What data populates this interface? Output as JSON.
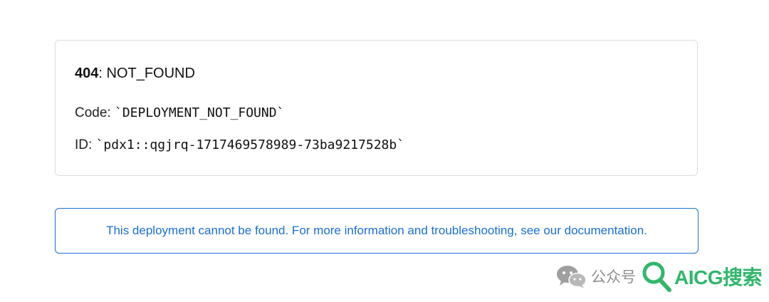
{
  "error": {
    "status_code": "404",
    "separator": ": ",
    "status_text": "NOT_FOUND",
    "code_label": "Code: ",
    "code_value": "`DEPLOYMENT_NOT_FOUND`",
    "id_label": "ID: ",
    "id_value": "`pdx1::qgjrq-1717469578989-73ba9217528b`"
  },
  "notice": {
    "message": "This deployment cannot be found. For more information and troubleshooting, see our documentation."
  },
  "watermark": {
    "chat_icon": "wechat-icon",
    "label": "公众号",
    "search_icon": "magnifier-icon",
    "brand": "AICG搜索"
  },
  "colors": {
    "link_blue": "#1a6fd6",
    "card_border": "#dcdcdc",
    "brand_green": "#25b463",
    "watermark_gray": "#8a8a8a"
  }
}
